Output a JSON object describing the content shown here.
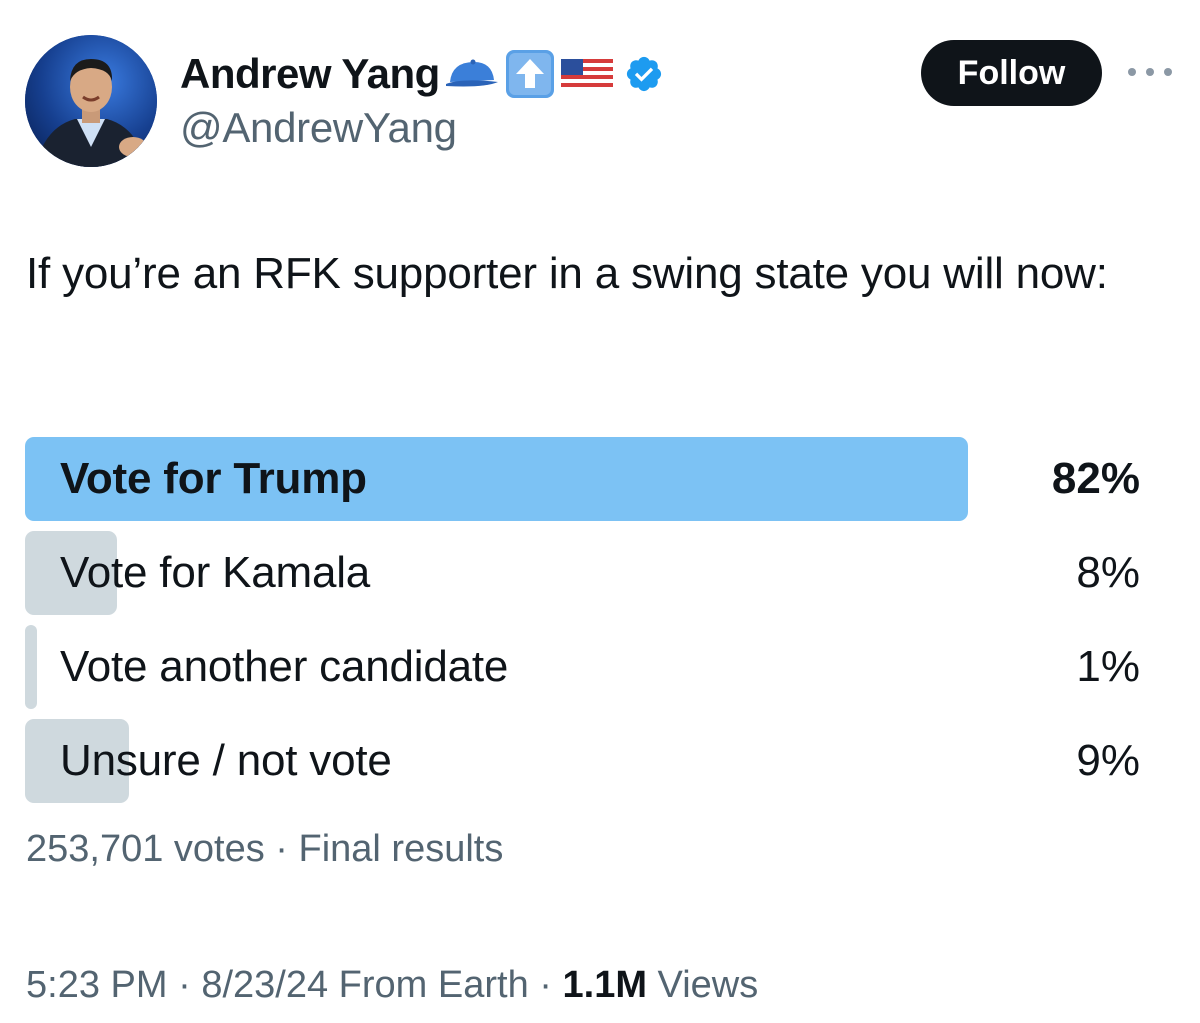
{
  "author": {
    "display_name": "Andrew Yang",
    "handle": "@AndrewYang",
    "badges": [
      "blue-cap-emoji",
      "up-arrow-emoji",
      "us-flag-emoji",
      "verified-badge-icon"
    ],
    "verified_color": "#1d9bf0"
  },
  "header": {
    "follow_label": "Follow"
  },
  "tweet": {
    "text": "If you’re an RFK supporter in a swing state you will now:"
  },
  "poll": {
    "options": [
      {
        "label": "Vote for Trump",
        "percent_label": "82%",
        "percent": 82,
        "winner": true
      },
      {
        "label": "Vote for Kamala",
        "percent_label": "8%",
        "percent": 8,
        "winner": false
      },
      {
        "label": "Vote another candidate",
        "percent_label": "1%",
        "percent": 1,
        "winner": false
      },
      {
        "label": "Unsure / not vote",
        "percent_label": "9%",
        "percent": 9,
        "winner": false
      }
    ],
    "footer": "253,701 votes · Final results",
    "winner_color": "#7cc2f4",
    "other_color": "#cfd9de"
  },
  "meta": {
    "time": "5:23 PM",
    "date": "8/23/24",
    "source": "From Earth",
    "views_count": "1.1M",
    "views_label": "Views"
  }
}
